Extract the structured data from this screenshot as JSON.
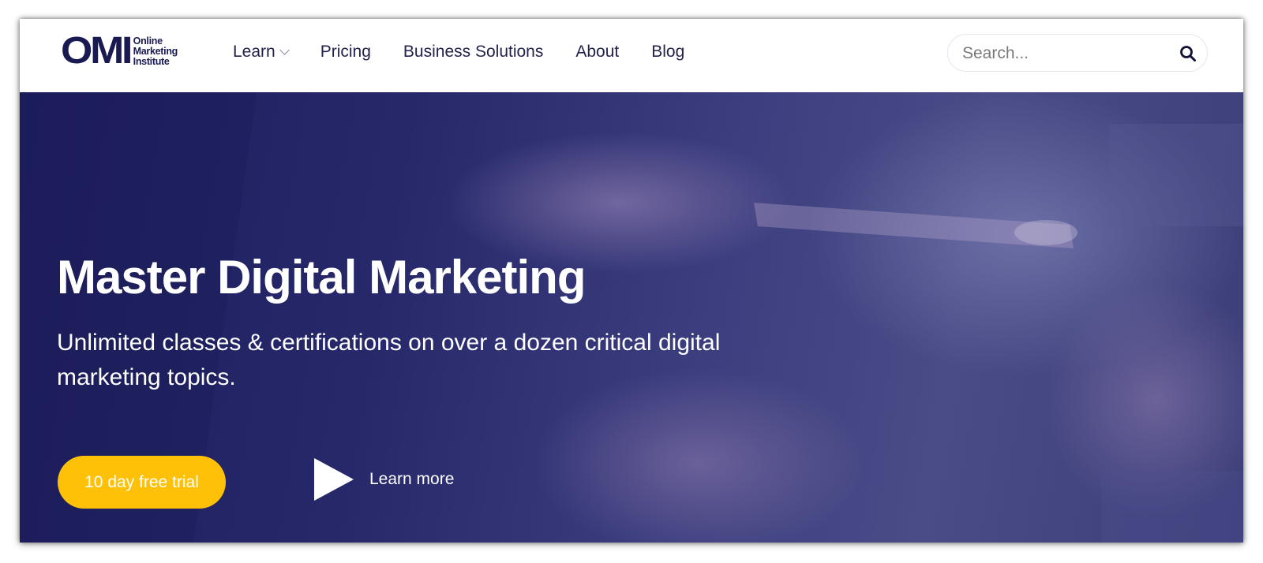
{
  "header": {
    "logo": {
      "mark": "OMI",
      "text_lines": [
        "Online",
        "Marketing",
        "Institute"
      ]
    },
    "nav": [
      {
        "label": "Learn",
        "has_dropdown": true
      },
      {
        "label": "Pricing"
      },
      {
        "label": "Business Solutions"
      },
      {
        "label": "About"
      },
      {
        "label": "Blog"
      }
    ],
    "search": {
      "placeholder": "Search...",
      "value": "",
      "icon": "search-icon"
    }
  },
  "hero": {
    "title": "Master Digital Marketing",
    "subtitle": "Unlimited classes & certifications on over a dozen critical digital marketing topics.",
    "cta_label": "10 day free trial",
    "learn_more_label": "Learn more",
    "learn_more_icon": "play-icon"
  },
  "colors": {
    "brand_navy": "#1a1a52",
    "nav_text": "#22224d",
    "hero_overlay": "#2a2c6e",
    "cta_yellow": "#ffc107",
    "white": "#ffffff"
  }
}
